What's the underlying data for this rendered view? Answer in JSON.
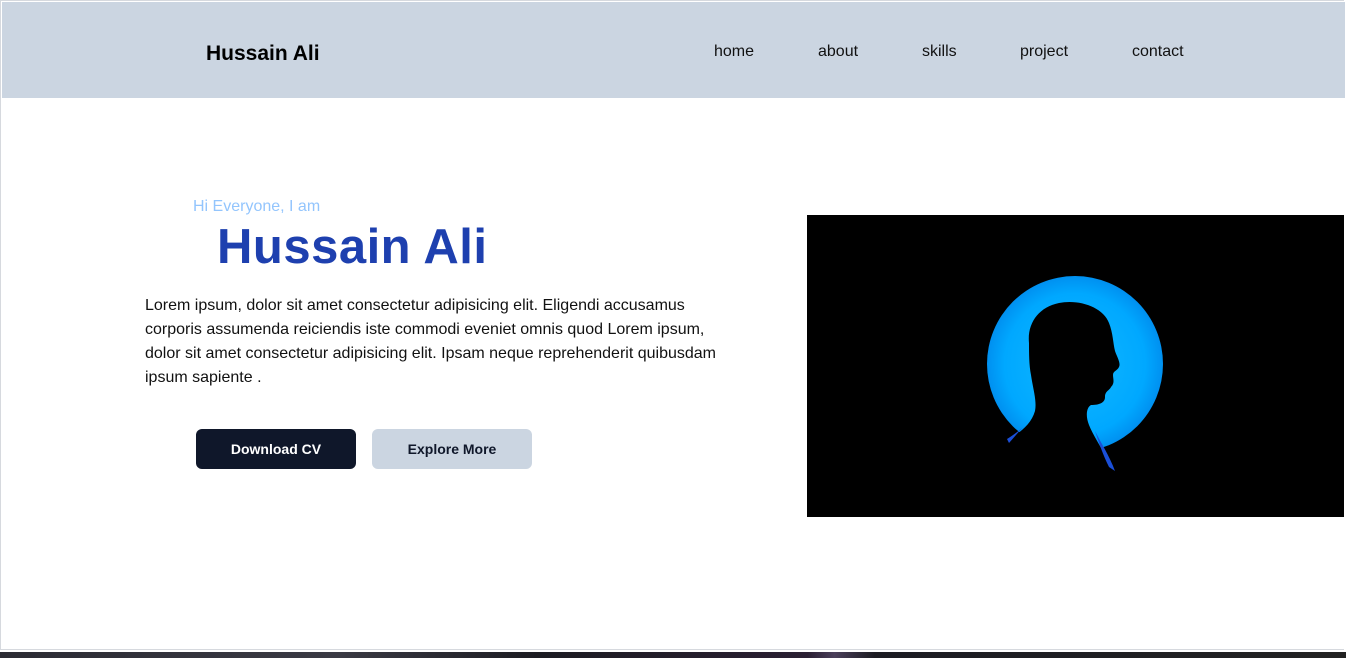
{
  "header": {
    "brand": "Hussain Ali",
    "nav": [
      "home",
      "about",
      "skills",
      "project",
      "contact"
    ]
  },
  "hero": {
    "greeting": "Hi Everyone, I am",
    "name": "Hussain Ali",
    "bio": "Lorem ipsum, dolor sit amet consectetur adipisicing elit. Eligendi accusamus corporis assumenda reiciendis iste commodi eveniet omnis quod Lorem ipsum, dolor sit amet consectetur adipisicing elit. Ipsam neque reprehenderit quibusdam ipsum sapiente .",
    "primary_button": "Download CV",
    "secondary_button": "Explore More",
    "image_icon": "person-silhouette-image"
  },
  "colors": {
    "navbar_bg": "#cbd5e1",
    "accent_blue": "#1e40af",
    "greeting_blue": "#93c5fd",
    "dark_button": "#0f172a",
    "halo_blue": "#00a8ff"
  }
}
